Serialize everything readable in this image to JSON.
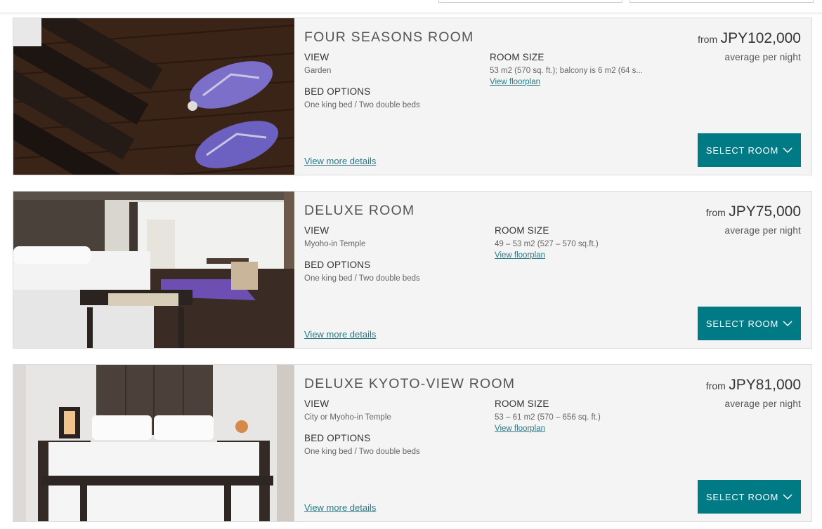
{
  "rooms": [
    {
      "title": "FOUR SEASONS ROOM",
      "view_label": "VIEW",
      "view_value": "Garden",
      "size_label": "ROOM SIZE",
      "size_value": "53 m2 (570 sq. ft.); balcony is 6 m2 (64 s...",
      "floorplan_link": "View floorplan",
      "bed_label": "BED OPTIONS",
      "bed_value": "One king bed / Two double beds",
      "more_link": "View more details",
      "price_from": "from",
      "price_amount": "JPY102,000",
      "price_note": "average per night",
      "select_label": "SELECT ROOM",
      "image": "wooden-floor-with-purple-sandals-photo"
    },
    {
      "title": "DELUXE ROOM",
      "view_label": "VIEW",
      "view_value": "Myoho-in Temple",
      "size_label": "ROOM SIZE",
      "size_value": "49 – 53 m2 (527 – 570 sq.ft.)",
      "floorplan_link": "View floorplan",
      "bed_label": "BED OPTIONS",
      "bed_value": "One king bed / Two double beds",
      "more_link": "View more details",
      "price_from": "from",
      "price_amount": "JPY75,000",
      "price_note": "average per night",
      "select_label": "SELECT ROOM",
      "image": "bedroom-with-window-and-bench-photo"
    },
    {
      "title": "DELUXE KYOTO-VIEW ROOM",
      "view_label": "VIEW",
      "view_value": "City or Myoho-in Temple",
      "size_label": "ROOM SIZE",
      "size_value": "53 – 61 m2 (570 – 656 sq. ft.)",
      "floorplan_link": "View floorplan",
      "bed_label": "BED OPTIONS",
      "bed_value": "One king bed / Two double beds",
      "more_link": "View more details",
      "price_from": "from",
      "price_amount": "JPY81,000",
      "price_note": "average per night",
      "select_label": "SELECT ROOM",
      "image": "bed-with-dark-headboard-and-lamps-photo"
    }
  ],
  "colors": {
    "accent": "#007a85",
    "link": "#2b7a86",
    "card_bg": "#f4f4f4"
  }
}
